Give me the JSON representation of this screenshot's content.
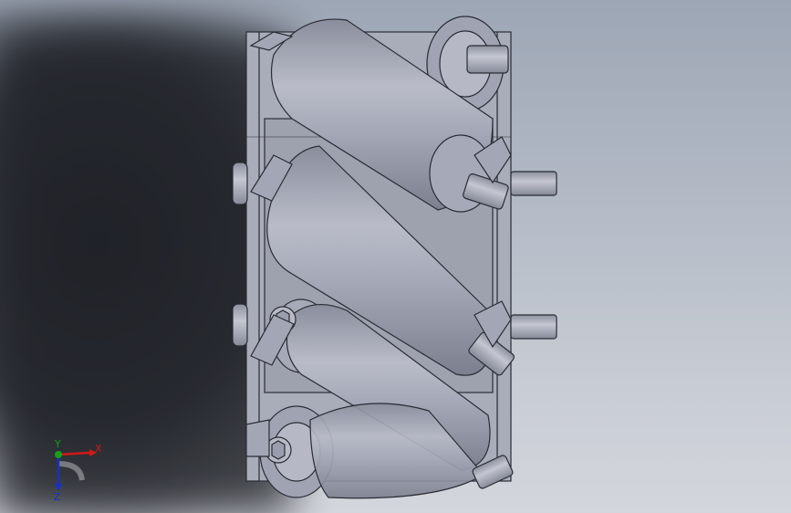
{
  "viewport": {
    "background_top": "#9da6b5",
    "background_bottom": "#d3d6dc",
    "model_color": "#a8acb8"
  },
  "triad": {
    "x_label": "X",
    "y_label": "Y",
    "z_label": "Z",
    "x_color": "#d01818",
    "y_color": "#18a018",
    "z_color": "#1830c8"
  }
}
